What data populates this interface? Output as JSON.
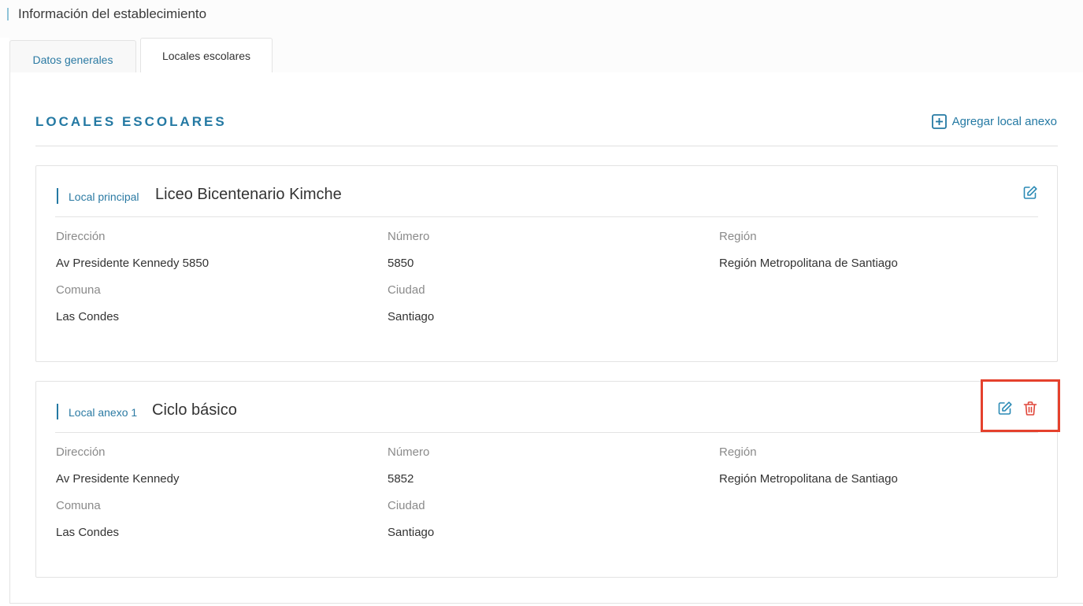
{
  "header": {
    "title": "Información del establecimiento"
  },
  "tabs": [
    {
      "label": "Datos generales",
      "active": false
    },
    {
      "label": "Locales escolares",
      "active": true
    }
  ],
  "section": {
    "title": "LOCALES ESCOLARES",
    "add_label": "Agregar local anexo",
    "add_icon": "plus-square-icon"
  },
  "locales": [
    {
      "kind": "Local principal",
      "name": "Liceo Bicentenario Kimche",
      "actions": [
        "edit-icon"
      ],
      "labels": {
        "direccion": "Dirección",
        "numero": "Número",
        "region": "Región",
        "comuna": "Comuna",
        "ciudad": "Ciudad"
      },
      "direccion": "Av Presidente Kennedy 5850",
      "numero": "5850",
      "region": "Región Metropolitana de Santiago",
      "comuna": "Las Condes",
      "ciudad": "Santiago"
    },
    {
      "kind": "Local anexo 1",
      "name": "Ciclo básico",
      "actions": [
        "edit-icon",
        "trash-icon"
      ],
      "labels": {
        "direccion": "Dirección",
        "numero": "Número",
        "region": "Región",
        "comuna": "Comuna",
        "ciudad": "Ciudad"
      },
      "direccion": "Av Presidente Kennedy",
      "numero": "5852",
      "region": "Región Metropolitana de Santiago",
      "comuna": "Las Condes",
      "ciudad": "Santiago"
    }
  ],
  "colors": {
    "accent": "#2479a3",
    "delete": "#e0463a",
    "highlight": "#e5412d",
    "border": "#e3e3e3"
  }
}
